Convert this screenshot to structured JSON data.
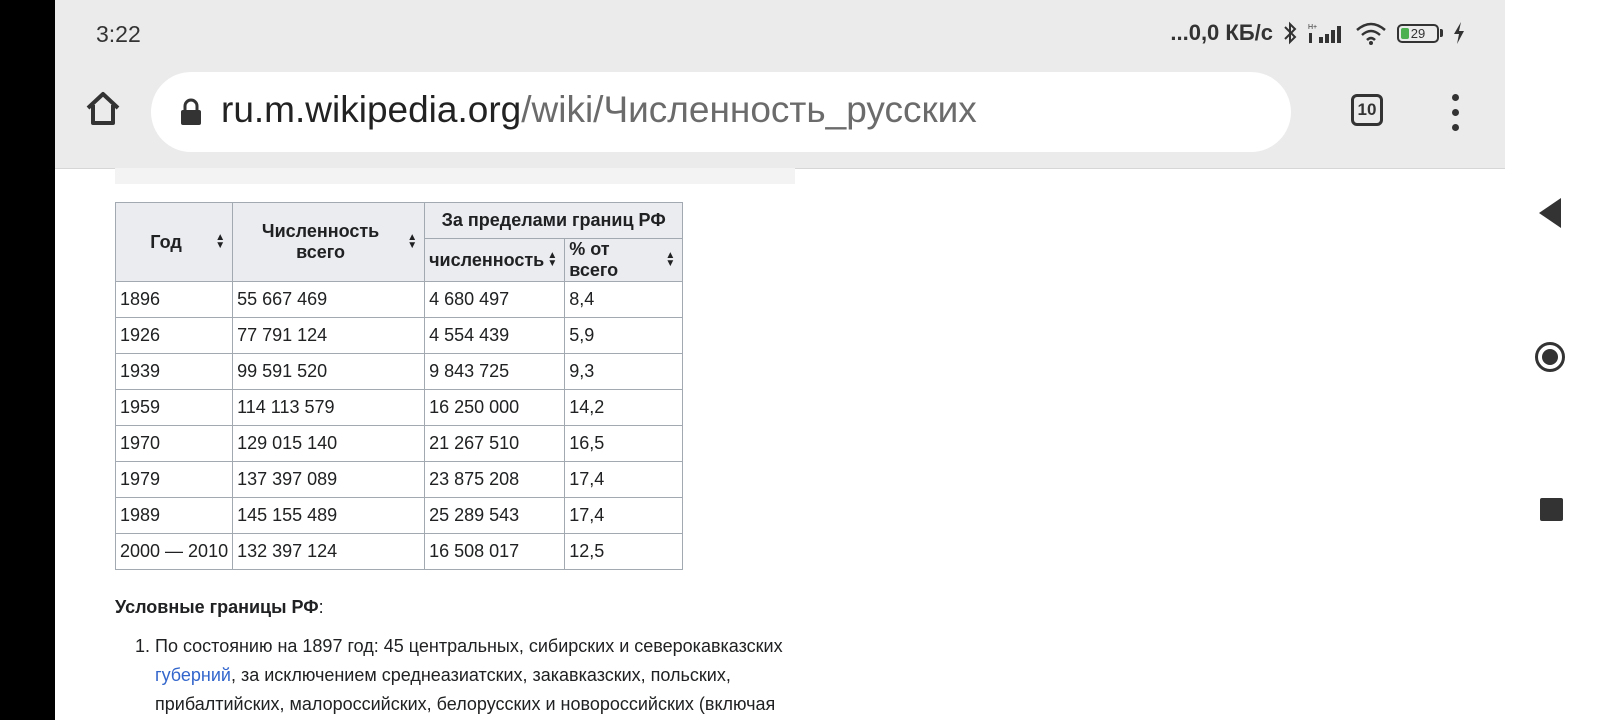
{
  "status_bar": {
    "time": "3:22",
    "net_speed": "...0,0 КБ/с",
    "battery": "29",
    "icons": [
      "bluetooth-icon",
      "signal-icon",
      "wifi-icon",
      "battery-icon",
      "charging-icon"
    ]
  },
  "browser": {
    "url_host": "ru.m.wikipedia.org",
    "url_path": "/wiki/Численность_русских",
    "tab_count": "10",
    "icons": [
      "home-icon",
      "lock-icon",
      "tabs-icon",
      "more-vert-icon"
    ]
  },
  "table": {
    "col_year": "Год",
    "col_total": "Численность всего",
    "col_group_outside": "За пределами границ РФ",
    "col_count": "численность",
    "col_percent": "% от всего",
    "rows": [
      {
        "year": "1896",
        "total": "55 667 469",
        "outside": "4 680 497",
        "percent": "8,4"
      },
      {
        "year": "1926",
        "total": "77 791 124",
        "outside": "4 554 439",
        "percent": "5,9"
      },
      {
        "year": "1939",
        "total": "99 591 520",
        "outside": "9 843 725",
        "percent": "9,3"
      },
      {
        "year": "1959",
        "total": "114 113 579",
        "outside": "16 250 000",
        "percent": "14,2"
      },
      {
        "year": "1970",
        "total": "129 015 140",
        "outside": "21 267 510",
        "percent": "16,5"
      },
      {
        "year": "1979",
        "total": "137 397 089",
        "outside": "23 875 208",
        "percent": "17,4"
      },
      {
        "year": "1989",
        "total": "145 155 489",
        "outside": "25 289 543",
        "percent": "17,4"
      },
      {
        "year": "2000 — 2010",
        "total": "132 397 124",
        "outside": "16 508 017",
        "percent": "12,5"
      }
    ]
  },
  "conditions": {
    "heading": "Условные границы РФ",
    "colon": ":",
    "item1_before": "По состоянию на 1897 год: 45 центральных, сибирских и северокавказских ",
    "item1_link": "губерний",
    "item1_after": ", за исключением среднеазиатских, закавказских, польских, прибалтийских, малороссийских, белорусских и новороссийских (включая"
  },
  "nav_bar": {
    "icons": [
      "back-icon",
      "home-circle-icon",
      "recents-icon"
    ]
  }
}
